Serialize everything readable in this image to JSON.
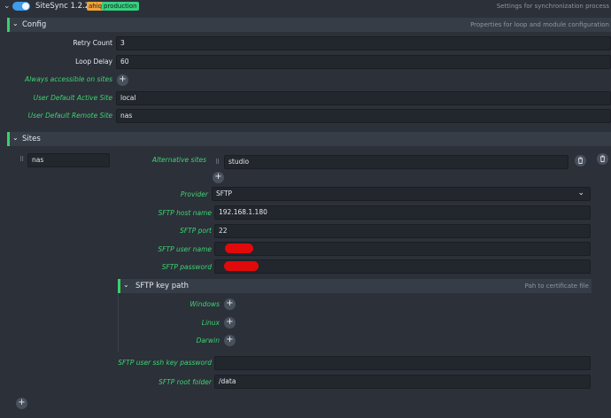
{
  "header": {
    "title": "SiteSync 1.2.2",
    "badge_ahiq": "ahiq",
    "badge_production": "production",
    "description": "Settings for synchronization process",
    "colors": {
      "toggle": "#3d9be9",
      "ahiq_badge": "#f2a33a",
      "production_badge": "#35d17f"
    }
  },
  "config": {
    "section_title": "Config",
    "section_hint": "Properties for loop and module configuration",
    "retry_count_label": "Retry Count",
    "retry_count_value": "3",
    "loop_delay_label": "Loop Delay",
    "loop_delay_value": "60",
    "always_accessible_label": "Always accessible on sites",
    "default_active_label": "User Default Active Site",
    "default_active_value": "local",
    "default_remote_label": "User Default Remote Site",
    "default_remote_value": "nas"
  },
  "sites": {
    "section_title": "Sites",
    "site_key": "nas",
    "alternative_sites_label": "Alternative sites",
    "alternative_sites_value": "studio",
    "provider_label": "Provider",
    "provider_value": "SFTP",
    "host_label": "SFTP host name",
    "host_value": "192.168.1.180",
    "port_label": "SFTP port",
    "port_value": "22",
    "user_label": "SFTP user name",
    "password_label": "SFTP password",
    "key_path": {
      "title": "SFTP key path",
      "hint": "Pah to certificate file",
      "windows_label": "Windows",
      "linux_label": "Linux",
      "darwin_label": "Darwin"
    },
    "ssh_key_password_label": "SFTP user ssh key password",
    "root_folder_label": "SFTP root folder",
    "root_folder_value": "/data"
  },
  "icons": [
    "chevron-down-icon",
    "toggle-switch",
    "plus-icon",
    "trash-icon",
    "drag-handle-icon"
  ]
}
